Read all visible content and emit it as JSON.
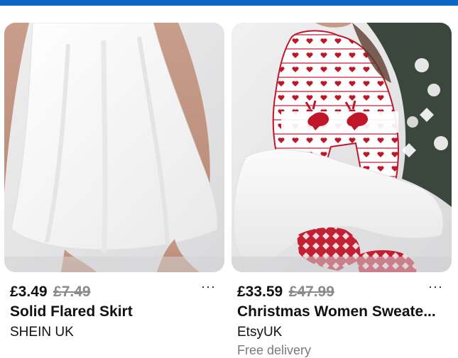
{
  "products": [
    {
      "price": "£3.49",
      "old_price": "£7.49",
      "title": "Solid Flared Skirt",
      "store": "SHEIN UK",
      "more": "···",
      "image_icon": "product-photo-white-skirt"
    },
    {
      "price": "£33.59",
      "old_price": "£47.99",
      "title": "Christmas Women Sweate...",
      "store": "EtsyUK",
      "delivery": "Free delivery",
      "more": "···",
      "image_icon": "product-photo-christmas-sweater"
    }
  ],
  "colors": {
    "accent": "#0a66c2",
    "sweater_red": "#c0162a"
  }
}
